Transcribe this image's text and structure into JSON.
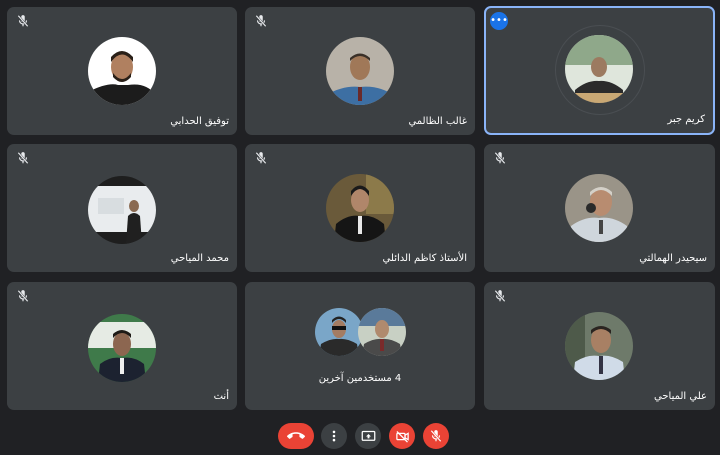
{
  "participants": [
    {
      "name": "توفيق الحدابي"
    },
    {
      "name": "غالب الظالمي"
    },
    {
      "name": "كريم جبر"
    },
    {
      "name": "محمد المياحي"
    },
    {
      "name": "الأستاذ كاظم الدائلي"
    },
    {
      "name": "سيحيدر الهمالتي"
    },
    {
      "name": "أنت"
    },
    {
      "name": "4 مستخدمين آخرين"
    },
    {
      "name": "علي المياحي"
    }
  ],
  "toolbar": {
    "buttons": [
      "end-call",
      "more-options",
      "present-now",
      "camera-off",
      "mic-off"
    ]
  },
  "colors": {
    "background": "#202124",
    "tile": "#3c4043",
    "active_border": "#8ab4f8",
    "accent": "#1a73e8",
    "end_call": "#ea4335"
  }
}
